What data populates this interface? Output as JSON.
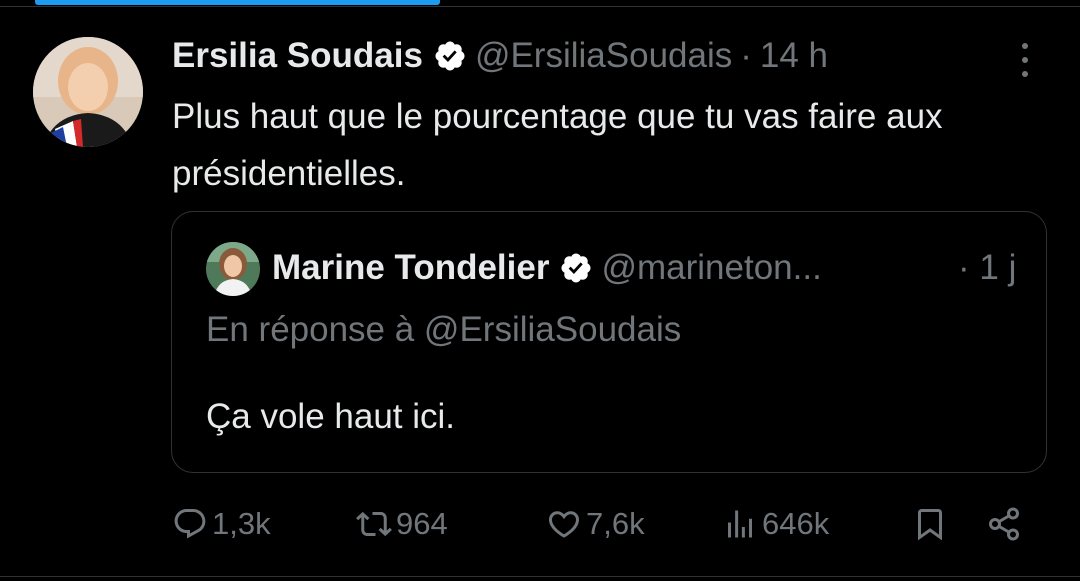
{
  "tweet": {
    "author_name": "Ersilia Soudais",
    "handle": "@ErsiliaSoudais",
    "separator": "·",
    "time": "14 h",
    "text": "Plus haut que le pourcentage que tu vas faire aux présidentielles."
  },
  "quoted": {
    "author_name": "Marine Tondelier",
    "handle": "@marineton...",
    "time": "· 1 j",
    "reply_context": "En réponse à @ErsiliaSoudais",
    "text": "Ça vole haut ici."
  },
  "actions": {
    "replies": "1,3k",
    "reposts": "964",
    "likes": "7,6k",
    "views": "646k"
  },
  "icons": {
    "verified": "verified-badge-icon",
    "more": "more-icon",
    "reply": "reply-icon",
    "repost": "repost-icon",
    "like": "heart-icon",
    "views": "views-icon",
    "bookmark": "bookmark-icon",
    "share": "share-icon"
  },
  "colors": {
    "background": "#000000",
    "text_primary": "#e7e9ea",
    "text_secondary": "#71767b",
    "accent": "#1d9bf0",
    "border": "#2f3336"
  }
}
